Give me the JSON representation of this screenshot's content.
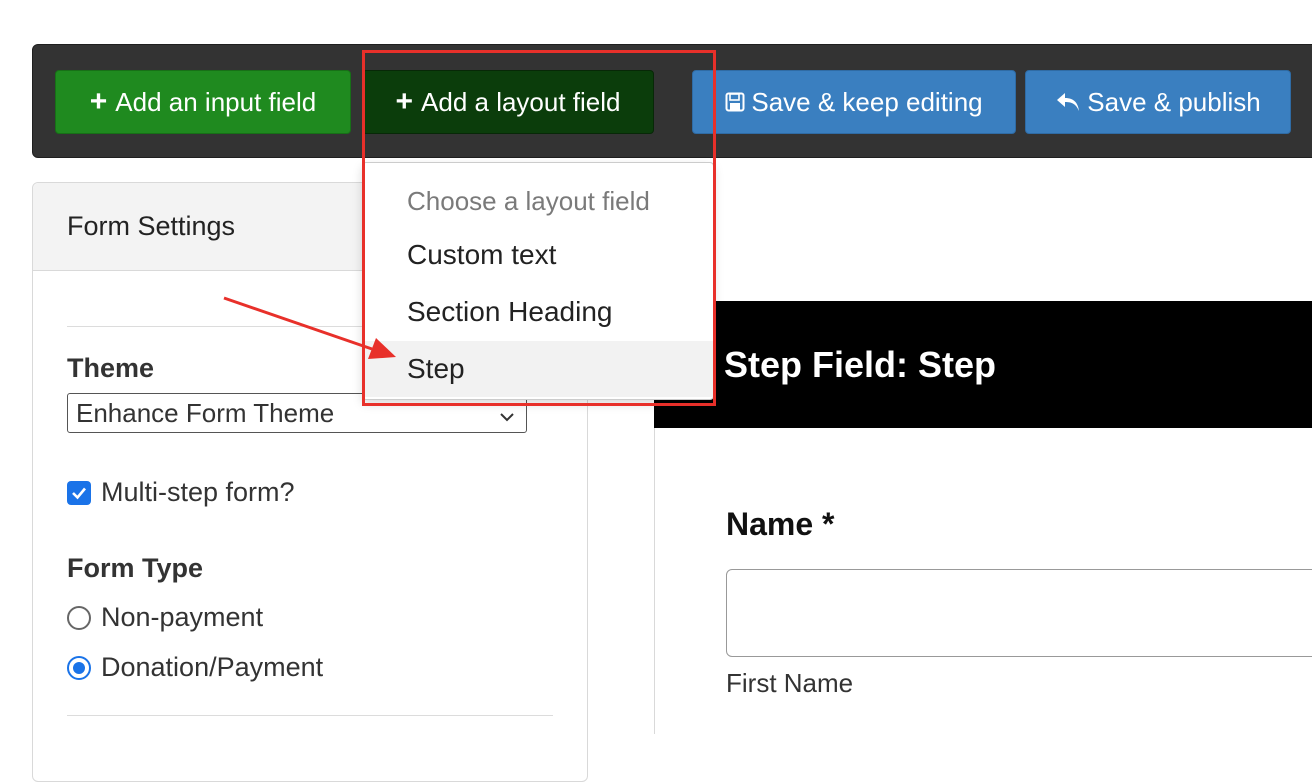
{
  "toolbar": {
    "add_input_label": "Add an input field",
    "add_layout_label": "Add a layout field",
    "save_keep_label": "Save & keep editing",
    "save_publish_label": "Save & publish"
  },
  "layout_menu": {
    "header": "Choose a layout field",
    "items": [
      "Custom text",
      "Section Heading",
      "Step"
    ]
  },
  "form_settings": {
    "title": "Form Settings",
    "theme_label": "Theme",
    "theme_value": "Enhance Form Theme",
    "multistep_label": "Multi-step form?",
    "multistep_checked": true,
    "form_type_label": "Form Type",
    "form_type_options": [
      "Non-payment",
      "Donation/Payment"
    ],
    "form_type_selected": "Donation/Payment"
  },
  "preview": {
    "step_heading": "Step Field: Step",
    "name_label": "Name *",
    "first_name_label": "First Name"
  },
  "colors": {
    "annotation": "#e8302a",
    "green_button": "#1f8a1f",
    "dark_green_button": "#0b3d0b",
    "blue_button": "#3a7fc0"
  }
}
